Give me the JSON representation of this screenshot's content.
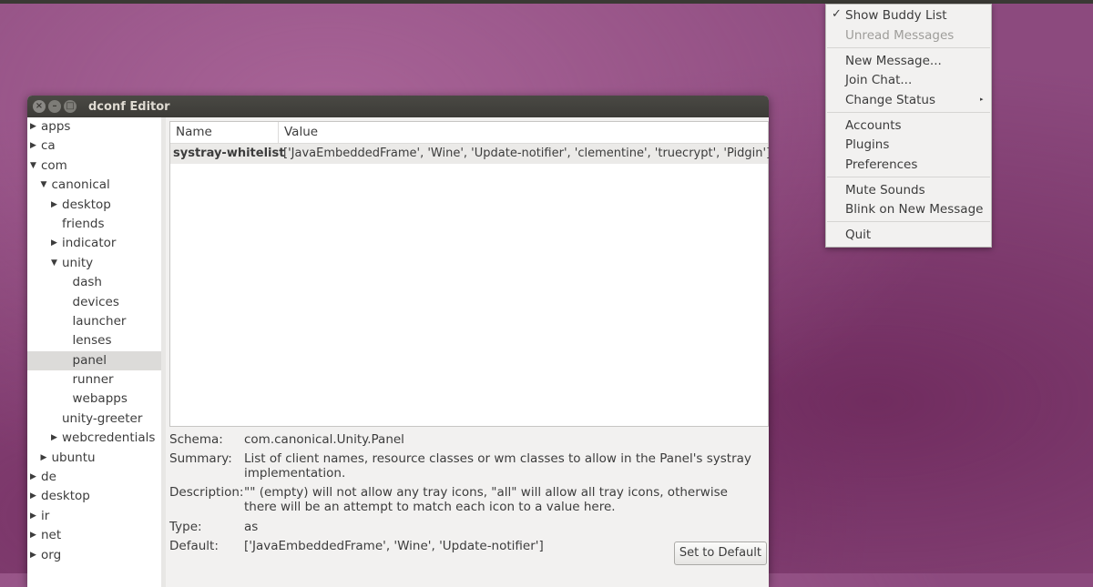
{
  "window": {
    "title": "dconf Editor"
  },
  "tree": [
    {
      "label": "apps",
      "depth": 0,
      "expander": "closed"
    },
    {
      "label": "ca",
      "depth": 0,
      "expander": "closed"
    },
    {
      "label": "com",
      "depth": 0,
      "expander": "open"
    },
    {
      "label": "canonical",
      "depth": 1,
      "expander": "open"
    },
    {
      "label": "desktop",
      "depth": 2,
      "expander": "closed"
    },
    {
      "label": "friends",
      "depth": 2,
      "expander": "none"
    },
    {
      "label": "indicator",
      "depth": 2,
      "expander": "closed"
    },
    {
      "label": "unity",
      "depth": 2,
      "expander": "open"
    },
    {
      "label": "dash",
      "depth": 3,
      "expander": "none"
    },
    {
      "label": "devices",
      "depth": 3,
      "expander": "none"
    },
    {
      "label": "launcher",
      "depth": 3,
      "expander": "none"
    },
    {
      "label": "lenses",
      "depth": 3,
      "expander": "none"
    },
    {
      "label": "panel",
      "depth": 3,
      "expander": "none",
      "selected": true
    },
    {
      "label": "runner",
      "depth": 3,
      "expander": "none"
    },
    {
      "label": "webapps",
      "depth": 3,
      "expander": "none"
    },
    {
      "label": "unity-greeter",
      "depth": 2,
      "expander": "none"
    },
    {
      "label": "webcredentials",
      "depth": 2,
      "expander": "closed"
    },
    {
      "label": "ubuntu",
      "depth": 1,
      "expander": "closed"
    },
    {
      "label": "de",
      "depth": 0,
      "expander": "closed"
    },
    {
      "label": "desktop",
      "depth": 0,
      "expander": "closed"
    },
    {
      "label": "ir",
      "depth": 0,
      "expander": "closed"
    },
    {
      "label": "net",
      "depth": 0,
      "expander": "closed"
    },
    {
      "label": "org",
      "depth": 0,
      "expander": "closed"
    }
  ],
  "list": {
    "headers": {
      "name": "Name",
      "value": "Value"
    },
    "rows": [
      {
        "name": "systray-whitelist",
        "value": "['JavaEmbeddedFrame', 'Wine', 'Update-notifier', 'clementine', 'truecrypt', 'Pidgin']"
      }
    ]
  },
  "details": {
    "schema_label": "Schema:",
    "schema": "com.canonical.Unity.Panel",
    "summary_label": "Summary:",
    "summary": "List of client names, resource classes or wm classes to allow in the Panel's systray implementation.",
    "description_label": "Description:",
    "description": "\"\" (empty) will not allow any tray icons, \"all\" will allow all tray icons, otherwise there will be an attempt to match each icon to a value here.",
    "type_label": "Type:",
    "type": "as",
    "default_label": "Default:",
    "default": "['JavaEmbeddedFrame', 'Wine', 'Update-notifier']",
    "set_default_button": "Set to Default"
  },
  "menu": {
    "items": [
      {
        "label": "Show Buddy List",
        "checked": true
      },
      {
        "label": "Unread Messages",
        "disabled": true
      },
      {
        "label": "New Message..."
      },
      {
        "label": "Join Chat..."
      },
      {
        "label": "Change Status",
        "submenu": true
      },
      {
        "label": "Accounts"
      },
      {
        "label": "Plugins"
      },
      {
        "label": "Preferences"
      },
      {
        "label": "Mute Sounds"
      },
      {
        "label": "Blink on New Message"
      },
      {
        "label": "Quit"
      }
    ],
    "check_icon": "checkmark-icon",
    "submenu_icon": "submenu-arrow-icon"
  },
  "colors": {
    "desktop": "#8c4a7e",
    "titlebar": "#3c3b37",
    "window_bg": "#f2f1f0",
    "selection": "#dcdbd9"
  }
}
